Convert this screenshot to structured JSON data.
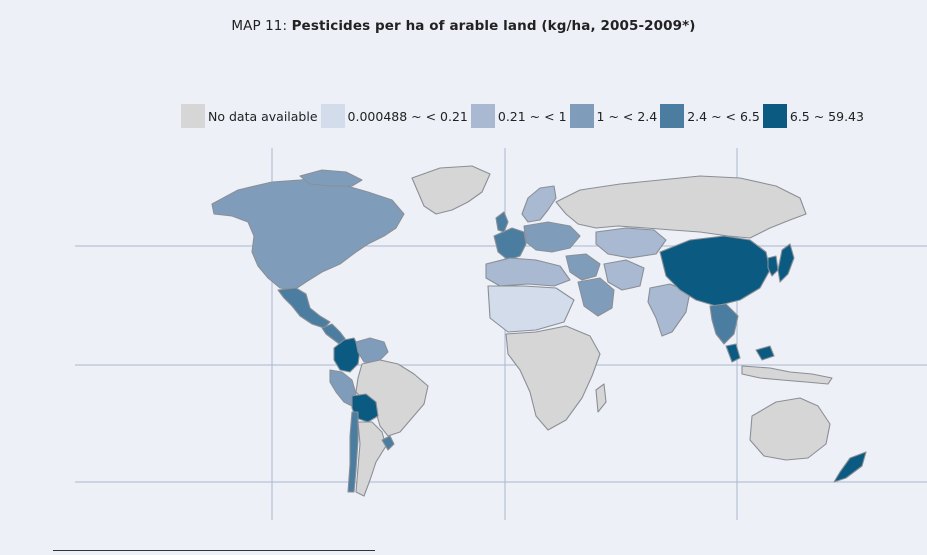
{
  "map": {
    "title_prefix": "MAP 11:",
    "title_main": "Pesticides per ha of arable land (kg/ha, 2005-2009*)",
    "legend": [
      {
        "label": "No data available",
        "color": "#d6d6d6"
      },
      {
        "label": "0.000488 ~ < 0.21",
        "color": "#d3dcea"
      },
      {
        "label": "0.21 ~ < 1",
        "color": "#a8b9d1"
      },
      {
        "label": "1 ~ < 2.4",
        "color": "#7f9dbb"
      },
      {
        "label": "2.4 ~ < 6.5",
        "color": "#4a7da0"
      },
      {
        "label": "6.5 ~ 59.43",
        "color": "#0a5a82"
      }
    ],
    "regions": [
      {
        "name": "North America",
        "class": "1 ~ < 2.4"
      },
      {
        "name": "Greenland",
        "class": "No data available"
      },
      {
        "name": "Mexico",
        "class": "2.4 ~ < 6.5"
      },
      {
        "name": "Central America",
        "class": "2.4 ~ < 6.5"
      },
      {
        "name": "Colombia",
        "class": "6.5 ~ 59.43"
      },
      {
        "name": "Venezuela",
        "class": "1 ~ < 2.4"
      },
      {
        "name": "Brazil",
        "class": "No data available"
      },
      {
        "name": "Peru",
        "class": "1 ~ < 2.4"
      },
      {
        "name": "Bolivia",
        "class": "6.5 ~ 59.43"
      },
      {
        "name": "Chile",
        "class": "2.4 ~ < 6.5"
      },
      {
        "name": "Argentina",
        "class": "No data available"
      },
      {
        "name": "Uruguay",
        "class": "2.4 ~ < 6.5"
      },
      {
        "name": "Western Europe",
        "class": "2.4 ~ < 6.5"
      },
      {
        "name": "Central Europe",
        "class": "1 ~ < 2.4"
      },
      {
        "name": "Scandinavia",
        "class": "0.21 ~ < 1"
      },
      {
        "name": "Russia",
        "class": "No data available"
      },
      {
        "name": "Kazakhstan",
        "class": "0.21 ~ < 1"
      },
      {
        "name": "Middle East",
        "class": "1 ~ < 2.4"
      },
      {
        "name": "Saudi Arabia",
        "class": "1 ~ < 2.4"
      },
      {
        "name": "Iran",
        "class": "0.21 ~ < 1"
      },
      {
        "name": "North Africa",
        "class": "0.21 ~ < 1"
      },
      {
        "name": "Sahara",
        "class": "0.000488 ~ < 0.21"
      },
      {
        "name": "Sub-Saharan Africa",
        "class": "No data available"
      },
      {
        "name": "India",
        "class": "0.21 ~ < 1"
      },
      {
        "name": "China",
        "class": "6.5 ~ 59.43"
      },
      {
        "name": "Japan",
        "class": "6.5 ~ 59.43"
      },
      {
        "name": "Korea",
        "class": "6.5 ~ 59.43"
      },
      {
        "name": "Southeast Asia",
        "class": "2.4 ~ < 6.5"
      },
      {
        "name": "Malaysia",
        "class": "6.5 ~ 59.43"
      },
      {
        "name": "Indonesia",
        "class": "No data available"
      },
      {
        "name": "Australia",
        "class": "No data available"
      },
      {
        "name": "New Zealand",
        "class": "6.5 ~ 59.43"
      }
    ]
  }
}
